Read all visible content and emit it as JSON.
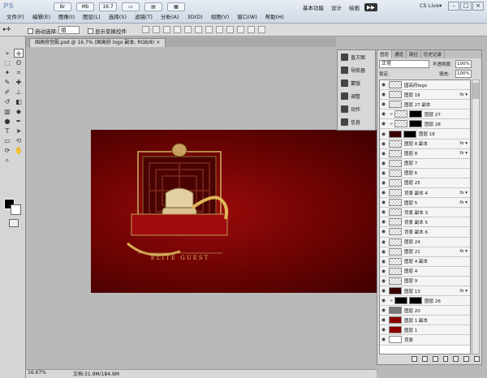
{
  "app": {
    "logo": "PS",
    "menu": [
      "文件(F)",
      "编辑(E)",
      "图像(I)",
      "图层(L)",
      "选择(S)",
      "滤镜(T)",
      "分析(A)",
      "3D(D)",
      "视图(V)",
      "窗口(W)",
      "帮助(H)"
    ],
    "top_buttons": [
      "Br",
      "Mb",
      "16.7",
      "▭",
      "▤",
      "▦"
    ],
    "workspaces": [
      {
        "label": "基本功能",
        "active": false
      },
      {
        "label": "设计",
        "active": false
      },
      {
        "label": "绘画",
        "active": false
      },
      {
        "label": "▶▶",
        "active": true
      }
    ],
    "cs_live": "CS Live▾",
    "window_buttons": [
      "–",
      "□",
      "×"
    ]
  },
  "options": {
    "tool_icon": "move-tool-icon",
    "auto_select_label": "自动选择:",
    "auto_select_value": "组",
    "show_transform_label": "显示变换控件"
  },
  "document": {
    "tab_label": "国高府宫殿.psd @ 16.7% (国高府 logo 副本, RGB/8) ×",
    "canvas_text": "ELITE GUEST",
    "zoom": "16.67%",
    "doc_info": "文档:31.9M/184.6M"
  },
  "mini_panel": [
    {
      "label": "直方图",
      "icon": "histogram-icon"
    },
    {
      "label": "导航器",
      "icon": "navigator-icon"
    },
    {
      "label": "蒙版",
      "icon": "masks-icon"
    },
    {
      "label": "调整",
      "icon": "adjustments-icon"
    },
    {
      "label": "动作",
      "icon": "actions-icon"
    },
    {
      "label": "信息",
      "icon": "info-icon"
    }
  ],
  "layers_panel": {
    "tabs": [
      {
        "label": "图层",
        "active": true
      },
      {
        "label": "通道",
        "active": false
      },
      {
        "label": "路径",
        "active": false
      },
      {
        "label": "历史记录",
        "active": false
      }
    ],
    "blend_mode": "正常",
    "opacity_label": "不透明度:",
    "opacity_value": "100%",
    "lock_label": "锁定:",
    "fill_label": "填充:",
    "fill_value": "100%",
    "layers": [
      {
        "name": "国高府logo",
        "fx": false,
        "thumb": "trans",
        "mask": false,
        "linked": false
      },
      {
        "name": "图层 16",
        "fx": true,
        "thumb": "trans",
        "mask": false,
        "linked": false
      },
      {
        "name": "图层 27 副本",
        "fx": false,
        "thumb": "trans",
        "mask": false,
        "linked": false
      },
      {
        "name": "图层 27",
        "fx": false,
        "thumb": "trans",
        "mask": true,
        "linked": true
      },
      {
        "name": "图层 28",
        "fx": false,
        "thumb": "trans",
        "mask": true,
        "linked": true
      },
      {
        "name": "图层 18",
        "fx": false,
        "thumb": "dark",
        "mask": true,
        "linked": false
      },
      {
        "name": "图层 8 副本",
        "fx": true,
        "thumb": "trans",
        "mask": false,
        "linked": false
      },
      {
        "name": "图层 8",
        "fx": true,
        "thumb": "trans",
        "mask": false,
        "linked": false
      },
      {
        "name": "图层 7",
        "fx": false,
        "thumb": "trans",
        "mask": false,
        "linked": false
      },
      {
        "name": "图层 6",
        "fx": false,
        "thumb": "trans",
        "mask": false,
        "linked": false
      },
      {
        "name": "图层 25",
        "fx": false,
        "thumb": "trans",
        "mask": false,
        "linked": false
      },
      {
        "name": "背景 副本 4",
        "fx": true,
        "thumb": "trans",
        "mask": false,
        "linked": false
      },
      {
        "name": "图层 5",
        "fx": true,
        "thumb": "trans",
        "mask": false,
        "linked": false
      },
      {
        "name": "背景 副本 3",
        "fx": false,
        "thumb": "trans",
        "mask": false,
        "linked": false
      },
      {
        "name": "背景 副本 5",
        "fx": false,
        "thumb": "trans",
        "mask": false,
        "linked": false
      },
      {
        "name": "背景 副本 6",
        "fx": false,
        "thumb": "trans",
        "mask": false,
        "linked": false
      },
      {
        "name": "图层 24",
        "fx": false,
        "thumb": "trans",
        "mask": false,
        "linked": false
      },
      {
        "name": "图层 21",
        "fx": true,
        "thumb": "trans",
        "mask": false,
        "linked": false
      },
      {
        "name": "图层 4 副本",
        "fx": false,
        "thumb": "trans",
        "mask": false,
        "linked": false
      },
      {
        "name": "图层 4",
        "fx": false,
        "thumb": "trans",
        "mask": false,
        "linked": false
      },
      {
        "name": "图层 9",
        "fx": false,
        "thumb": "trans",
        "mask": false,
        "linked": false
      },
      {
        "name": "图层 13",
        "fx": true,
        "thumb": "dark",
        "mask": false,
        "linked": false
      },
      {
        "name": "图层 26",
        "fx": false,
        "thumb": "black",
        "mask": true,
        "linked": true
      },
      {
        "name": "图层 20",
        "fx": false,
        "thumb": "gray",
        "mask": false,
        "linked": false
      },
      {
        "name": "图层 1 副本",
        "fx": false,
        "thumb": "red",
        "mask": false,
        "linked": false
      },
      {
        "name": "图层 1",
        "fx": false,
        "thumb": "red",
        "mask": false,
        "linked": false
      },
      {
        "name": "背景",
        "fx": false,
        "thumb": "white",
        "mask": false,
        "linked": false
      }
    ]
  }
}
